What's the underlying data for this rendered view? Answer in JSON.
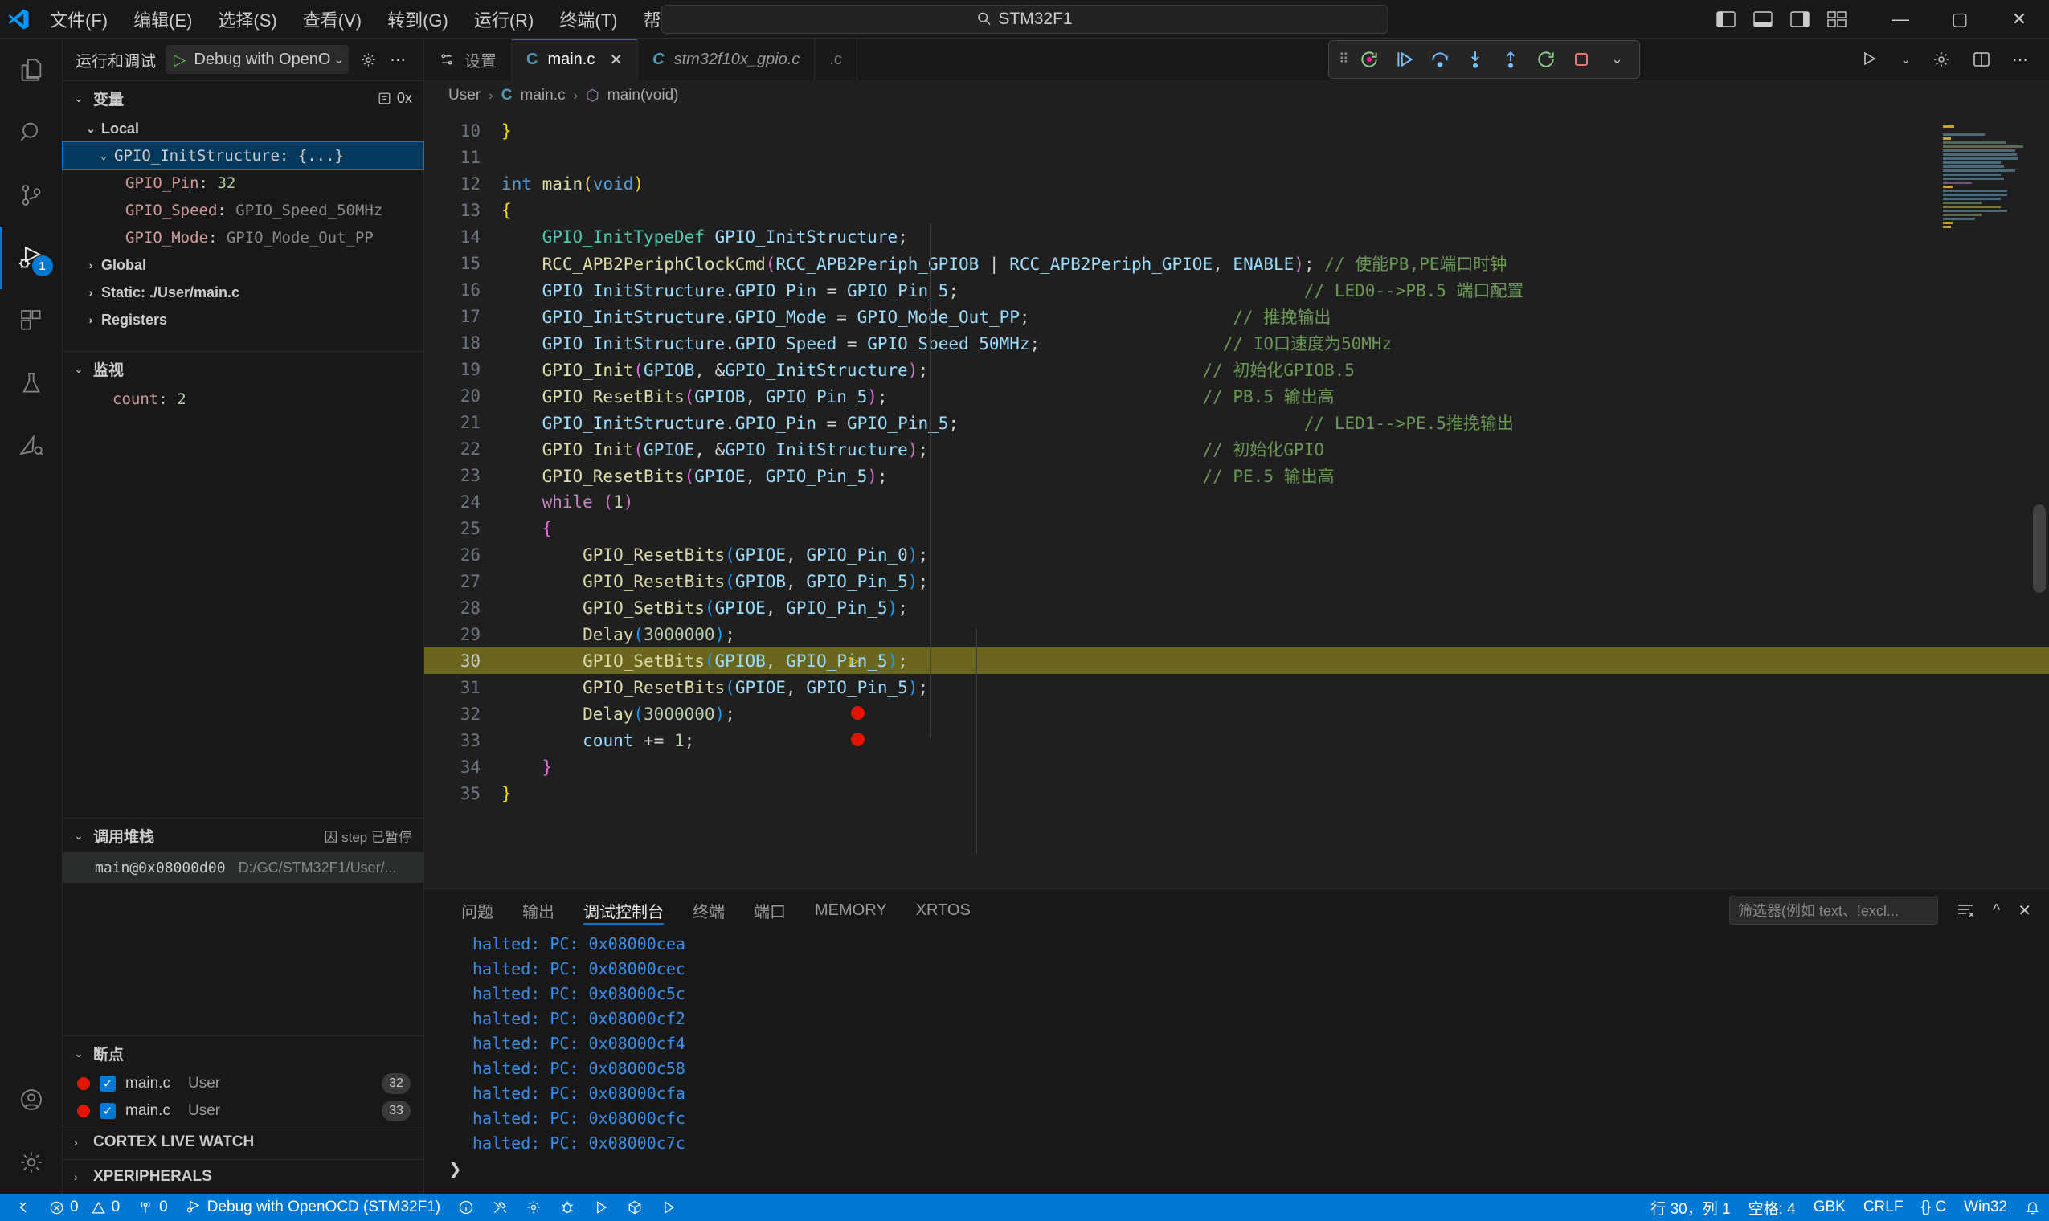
{
  "titlebar": {
    "menus": [
      "文件(F)",
      "编辑(E)",
      "选择(S)",
      "查看(V)",
      "转到(G)",
      "运行(R)",
      "终端(T)",
      "帮助(H)"
    ],
    "back_icon": "arrow-left-icon",
    "forward_icon": "arrow-right-icon",
    "search_value": "STM32F1",
    "search_icon": "search-icon",
    "layout_icons": [
      "toggle-primary-sidebar-icon",
      "toggle-panel-icon",
      "toggle-secondary-sidebar-icon",
      "customize-layout-icon"
    ],
    "window_minimize": "—",
    "window_maximize": "▢",
    "window_close": "✕"
  },
  "activitybar": {
    "items": [
      {
        "name": "explorer",
        "icon": "files-icon",
        "active": false,
        "badge": ""
      },
      {
        "name": "search",
        "icon": "search-icon",
        "active": false,
        "badge": ""
      },
      {
        "name": "source-control",
        "icon": "source-control-icon",
        "active": false,
        "badge": ""
      },
      {
        "name": "run-and-debug",
        "icon": "run-and-debug-icon",
        "active": true,
        "badge": "1"
      },
      {
        "name": "extensions",
        "icon": "extensions-icon",
        "active": false,
        "badge": ""
      },
      {
        "name": "testing",
        "icon": "beaker-icon",
        "active": false,
        "badge": ""
      },
      {
        "name": "embedded-tools",
        "icon": "embedded-tools-icon",
        "active": false,
        "badge": ""
      }
    ],
    "bottom": [
      {
        "name": "accounts",
        "icon": "account-icon"
      },
      {
        "name": "manage",
        "icon": "gear-icon"
      }
    ]
  },
  "sidebar": {
    "title": "运行和调试",
    "launch_config": "Debug with OpenO",
    "launch_play_icon": "play-icon",
    "launch_caret_icon": "chevron-down-icon",
    "gear_icon": "gear-icon",
    "more_icon": "ellipsis-icon",
    "variables": {
      "header": "变量",
      "hex_toggle": "0x",
      "filter_icon": "filter-icon",
      "scopes": [
        {
          "label": "Local",
          "expanded": true
        },
        {
          "label": "Global",
          "expanded": false
        },
        {
          "label": "Static: ./User/main.c",
          "expanded": false
        },
        {
          "label": "Registers",
          "expanded": false
        }
      ],
      "local_struct": {
        "name": "GPIO_InitStructure",
        "value": "{...}",
        "selected": true
      },
      "local_members": [
        {
          "name": "GPIO_Pin",
          "value": "32",
          "kind": "num"
        },
        {
          "name": "GPIO_Speed",
          "value": "GPIO_Speed_50MHz",
          "kind": "str"
        },
        {
          "name": "GPIO_Mode",
          "value": "GPIO_Mode_Out_PP",
          "kind": "str"
        }
      ]
    },
    "watch": {
      "header": "监视",
      "items": [
        {
          "name": "count",
          "value": "2"
        }
      ]
    },
    "callstack": {
      "header": "调用堆栈",
      "status": "因 step 已暂停",
      "frames": [
        {
          "name": "main@0x08000d00",
          "path": "D:/GC/STM32F1/User/..."
        }
      ]
    },
    "breakpoints": {
      "header": "断点",
      "items": [
        {
          "file": "main.c",
          "owner": "User",
          "line": "32",
          "enabled": true
        },
        {
          "file": "main.c",
          "owner": "User",
          "line": "33",
          "enabled": true
        }
      ]
    },
    "extra_sections": [
      {
        "label": "CORTEX LIVE WATCH"
      },
      {
        "label": "XPERIPHERALS"
      }
    ]
  },
  "editor": {
    "tabs": [
      {
        "label": "设置",
        "icon": "settings-gear-icon",
        "active": false,
        "italic": false,
        "closable": false
      },
      {
        "label": "main.c",
        "icon": "c-file-icon",
        "active": true,
        "italic": false,
        "closable": true
      },
      {
        "label": "stm32f10x_gpio.c",
        "icon": "c-file-icon",
        "active": false,
        "italic": true,
        "closable": false
      }
    ],
    "tab_overflow_label": ".c",
    "tabs_right_icons": [
      "run-or-debug-icon",
      "split-editor-icon",
      "more-actions-icon",
      "settings-icon"
    ],
    "debug_toolbar": [
      {
        "name": "grip",
        "icon": "drag-handle-icon"
      },
      {
        "name": "restart",
        "icon": "restart-icon"
      },
      {
        "name": "continue",
        "icon": "continue-icon"
      },
      {
        "name": "step-over",
        "icon": "step-over-icon"
      },
      {
        "name": "step-into",
        "icon": "step-into-icon"
      },
      {
        "name": "step-out",
        "icon": "step-out-icon"
      },
      {
        "name": "restart-session",
        "icon": "restart-session-icon"
      },
      {
        "name": "stop",
        "icon": "stop-icon"
      },
      {
        "name": "dropdown",
        "icon": "chevron-down-icon"
      }
    ],
    "breadcrumbs": [
      "User",
      "main.c",
      "main(void)"
    ],
    "current_line": 30,
    "first_line": 10,
    "breakpoint_lines": [
      32,
      33
    ],
    "lines": [
      {
        "n": 10,
        "code": "}"
      },
      {
        "n": 11,
        "code": ""
      },
      {
        "n": 12,
        "code": "int main(void)"
      },
      {
        "n": 13,
        "code": "{"
      },
      {
        "n": 14,
        "code": "    GPIO_InitTypeDef GPIO_InitStructure;"
      },
      {
        "n": 15,
        "code": "    RCC_APB2PeriphClockCmd(RCC_APB2Periph_GPIOB | RCC_APB2Periph_GPIOE, ENABLE);",
        "comment": "// 使能PB,PE端口时钟"
      },
      {
        "n": 16,
        "code": "    GPIO_InitStructure.GPIO_Pin = GPIO_Pin_5;",
        "comment": "// LED0-->PB.5 端口配置"
      },
      {
        "n": 17,
        "code": "    GPIO_InitStructure.GPIO_Mode = GPIO_Mode_Out_PP;",
        "comment": "// 推挽输出"
      },
      {
        "n": 18,
        "code": "    GPIO_InitStructure.GPIO_Speed = GPIO_Speed_50MHz;",
        "comment": "// IO口速度为50MHz"
      },
      {
        "n": 19,
        "code": "    GPIO_Init(GPIOB, &GPIO_InitStructure);",
        "comment": "// 初始化GPIOB.5"
      },
      {
        "n": 20,
        "code": "    GPIO_ResetBits(GPIOB, GPIO_Pin_5);",
        "comment": "// PB.5 输出高"
      },
      {
        "n": 21,
        "code": "    GPIO_InitStructure.GPIO_Pin = GPIO_Pin_5;",
        "comment": "// LED1-->PE.5推挽输出"
      },
      {
        "n": 22,
        "code": "    GPIO_Init(GPIOE, &GPIO_InitStructure);",
        "comment": "// 初始化GPIO"
      },
      {
        "n": 23,
        "code": "    GPIO_ResetBits(GPIOE, GPIO_Pin_5);",
        "comment": "// PE.5 输出高"
      },
      {
        "n": 24,
        "code": "    while (1)"
      },
      {
        "n": 25,
        "code": "    {"
      },
      {
        "n": 26,
        "code": "        GPIO_ResetBits(GPIOE, GPIO_Pin_0);"
      },
      {
        "n": 27,
        "code": "        GPIO_ResetBits(GPIOB, GPIO_Pin_5);"
      },
      {
        "n": 28,
        "code": "        GPIO_SetBits(GPIOE, GPIO_Pin_5);"
      },
      {
        "n": 29,
        "code": "        Delay(3000000);"
      },
      {
        "n": 30,
        "code": "        GPIO_SetBits(GPIOB, GPIO_Pin_5);"
      },
      {
        "n": 31,
        "code": "        GPIO_ResetBits(GPIOE, GPIO_Pin_5);"
      },
      {
        "n": 32,
        "code": "        Delay(3000000);"
      },
      {
        "n": 33,
        "code": "        count += 1;"
      },
      {
        "n": 34,
        "code": "    }"
      },
      {
        "n": 35,
        "code": "}"
      }
    ]
  },
  "panel": {
    "tabs": [
      "问题",
      "输出",
      "调试控制台",
      "终端",
      "端口",
      "MEMORY",
      "XRTOS"
    ],
    "active_tab": "调试控制台",
    "filter_placeholder": "筛选器(例如 text、!excl...",
    "icons": [
      "clear-console-icon",
      "chevron-up-icon",
      "close-icon"
    ],
    "console_lines": [
      "halted: PC: 0x08000cea",
      "halted: PC: 0x08000cec",
      "halted: PC: 0x08000c5c",
      "halted: PC: 0x08000cf2",
      "halted: PC: 0x08000cf4",
      "halted: PC: 0x08000c58",
      "halted: PC: 0x08000cfa",
      "halted: PC: 0x08000cfc",
      "halted: PC: 0x08000c7c"
    ],
    "prompt_icon": "chevron-right-icon"
  },
  "statusbar": {
    "left": [
      {
        "name": "remote-indicator",
        "icon": "remote-icon",
        "text": ""
      },
      {
        "name": "problems-errors",
        "icon": "error-icon",
        "text": "0"
      },
      {
        "name": "problems-warnings",
        "icon": "warning-icon",
        "text": "0"
      },
      {
        "name": "radio-tower",
        "icon": "radio-tower-icon",
        "text": "0"
      },
      {
        "name": "debug-launch-config",
        "icon": "debug-icon",
        "text": "Debug with OpenOCD (STM32F1)"
      },
      {
        "name": "info",
        "icon": "info-icon",
        "text": ""
      },
      {
        "name": "build-tools",
        "icon": "tools-icon",
        "text": ""
      },
      {
        "name": "settings",
        "icon": "gear-icon",
        "text": ""
      },
      {
        "name": "debug-bug",
        "icon": "bug-icon",
        "text": ""
      },
      {
        "name": "run",
        "icon": "play-icon",
        "text": ""
      },
      {
        "name": "package",
        "icon": "package-icon",
        "text": ""
      },
      {
        "name": "run-alt",
        "icon": "play-icon",
        "text": ""
      }
    ],
    "right": [
      {
        "name": "cursor-position",
        "text": "行 30，列 1"
      },
      {
        "name": "indentation",
        "text": "空格: 4"
      },
      {
        "name": "encoding",
        "text": "GBK"
      },
      {
        "name": "eol",
        "text": "CRLF"
      },
      {
        "name": "language-mode",
        "text": "{} C"
      },
      {
        "name": "platform",
        "text": "Win32"
      },
      {
        "name": "notifications",
        "text": "",
        "icon": "bell-icon"
      }
    ]
  },
  "colors": {
    "accent": "#0078d4",
    "statusbar_bg": "#0078d4",
    "editor_bg": "#1f1f1f",
    "sidebar_bg": "#181818",
    "breakpoint_red": "#e51400",
    "highlight_line": "#6b661f",
    "comment_green": "#6a9955"
  }
}
